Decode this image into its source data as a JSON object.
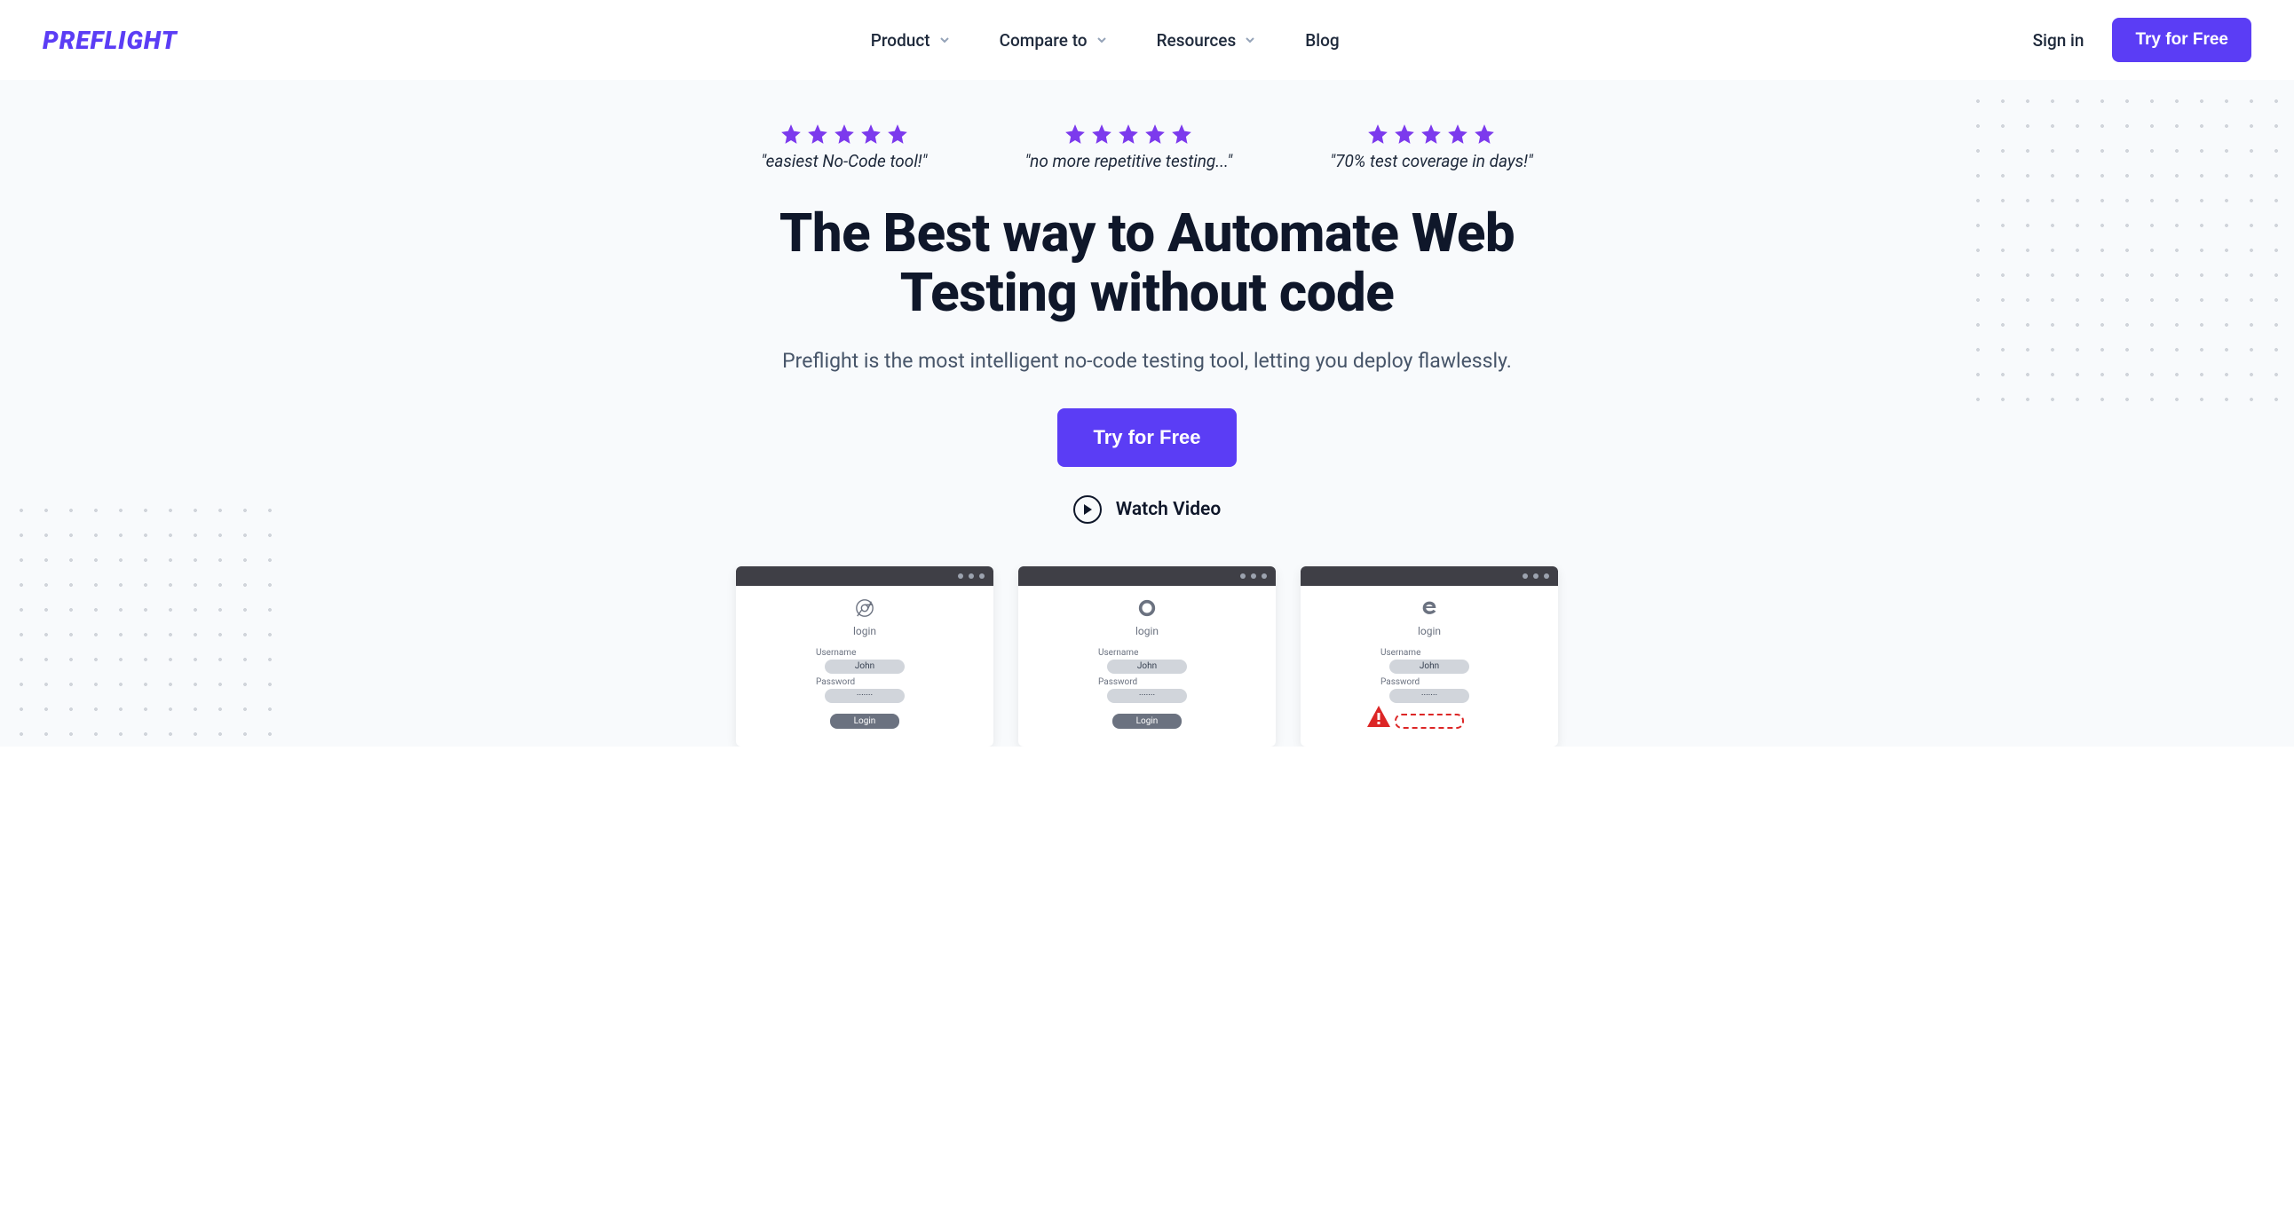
{
  "header": {
    "logo_text": "PREFLIGHT",
    "nav": [
      {
        "label": "Product",
        "has_dropdown": true
      },
      {
        "label": "Compare to",
        "has_dropdown": true
      },
      {
        "label": "Resources",
        "has_dropdown": true
      },
      {
        "label": "Blog",
        "has_dropdown": false
      }
    ],
    "sign_in_label": "Sign in",
    "cta_label": "Try for Free"
  },
  "hero": {
    "reviews": [
      {
        "quote": "\"easiest No-Code tool!\""
      },
      {
        "quote": "\"no more repetitive testing...\""
      },
      {
        "quote": "\"70% test coverage in days!\""
      }
    ],
    "title": "The Best way to Automate Web Testing without code",
    "subtitle": "Preflight is the most intelligent no-code testing tool, letting you deploy flawlessly.",
    "cta_label": "Try for Free",
    "watch_label": "Watch Video"
  },
  "previews": {
    "login_title": "login",
    "username_label": "Username",
    "username_value": "John",
    "password_label": "Password",
    "password_value": "·······",
    "login_button_label": "Login"
  }
}
